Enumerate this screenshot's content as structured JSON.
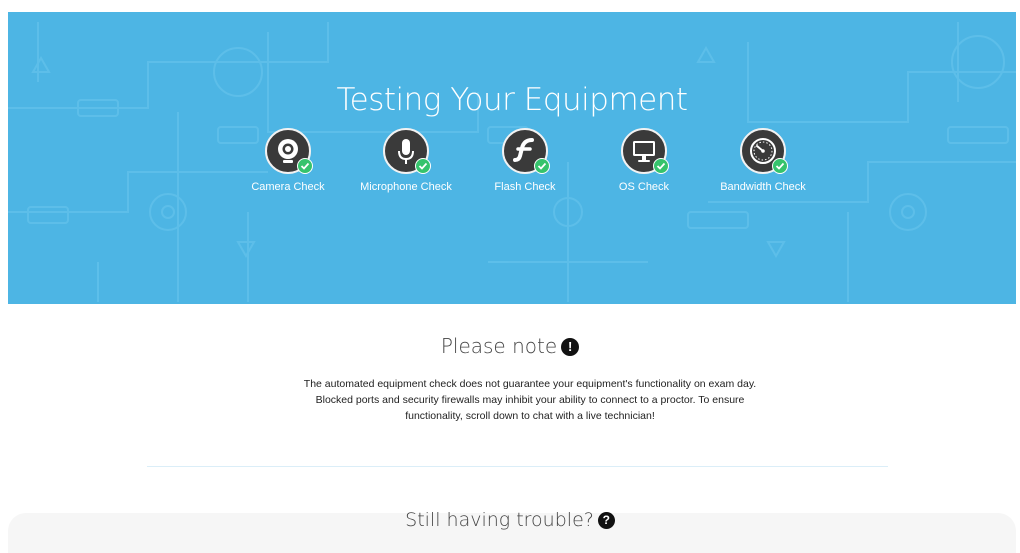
{
  "hero": {
    "title": "Testing Your Equipment",
    "background_color": "#4db5e4",
    "checks": [
      {
        "label": "Camera Check",
        "icon": "webcam-icon",
        "status": "passed"
      },
      {
        "label": "Microphone Check",
        "icon": "microphone-icon",
        "status": "passed"
      },
      {
        "label": "Flash Check",
        "icon": "flash-icon",
        "status": "passed"
      },
      {
        "label": "OS Check",
        "icon": "monitor-icon",
        "status": "passed"
      },
      {
        "label": "Bandwidth Check",
        "icon": "speedometer-icon",
        "status": "passed"
      }
    ]
  },
  "note": {
    "title": "Please note",
    "text": "The automated equipment check does not guarantee your equipment's functionality on exam day. Blocked ports and security firewalls may inhibit your ability to connect to a proctor. To ensure functionality, scroll down to chat with a live technician!",
    "icon": "exclamation-circle-icon"
  },
  "trouble": {
    "title": "Still having trouble?",
    "icon": "question-circle-icon"
  },
  "colors": {
    "accent": "#4db5e4",
    "success": "#36c36c",
    "icon_bg": "#3a3a3a"
  }
}
